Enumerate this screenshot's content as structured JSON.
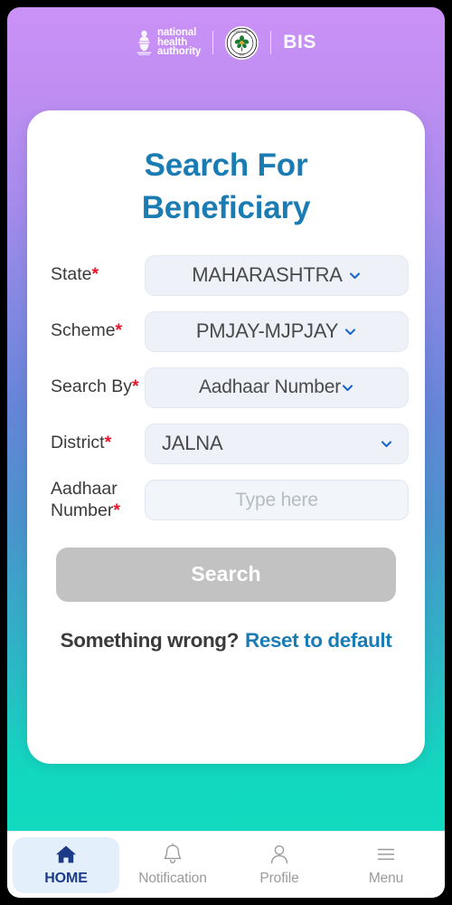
{
  "header": {
    "logo_name": "national-health-authority-logo",
    "logo_lines": [
      "national",
      "health",
      "authority"
    ],
    "seal_name": "government-seal-icon",
    "bis_label": "BIS"
  },
  "card": {
    "title": "Search For Beneficiary",
    "fields": [
      {
        "name": "state",
        "label": "State",
        "required": true,
        "type": "select",
        "value": "MAHARASHTRA",
        "align": "center"
      },
      {
        "name": "scheme",
        "label": "Scheme",
        "required": true,
        "type": "select",
        "value": "PMJAY-MJPJAY",
        "align": "center"
      },
      {
        "name": "search-by",
        "label": "Search By",
        "required": true,
        "type": "select",
        "value": "Aadhaar Number",
        "align": "center"
      },
      {
        "name": "district",
        "label": "District",
        "required": true,
        "type": "select",
        "value": "JALNA",
        "align": "left"
      },
      {
        "name": "aadhaar-number",
        "label": "Aadhaar Number",
        "required": true,
        "type": "text",
        "value": "",
        "placeholder": "Type here"
      }
    ],
    "search_button_label": "Search",
    "reset_question": "Something wrong?",
    "reset_link_label": "Reset to default"
  },
  "bottom_nav": {
    "items": [
      {
        "label": "HOME",
        "icon": "home-icon",
        "active": true
      },
      {
        "label": "Notification",
        "icon": "bell-icon",
        "active": false
      },
      {
        "label": "Profile",
        "icon": "person-icon",
        "active": false
      },
      {
        "label": "Menu",
        "icon": "hamburger-menu-icon",
        "active": false
      }
    ]
  },
  "colors": {
    "gradient_top": "#cb91f6",
    "gradient_mid": "#6585d8",
    "gradient_bottom": "#0fdcc0",
    "accent_blue": "#1b7cb4",
    "required_red": "#e8152b",
    "disabled_gray": "#c2c2c2",
    "nav_active_bg": "#e3f0fb",
    "nav_active_fg": "#1b3b86"
  }
}
